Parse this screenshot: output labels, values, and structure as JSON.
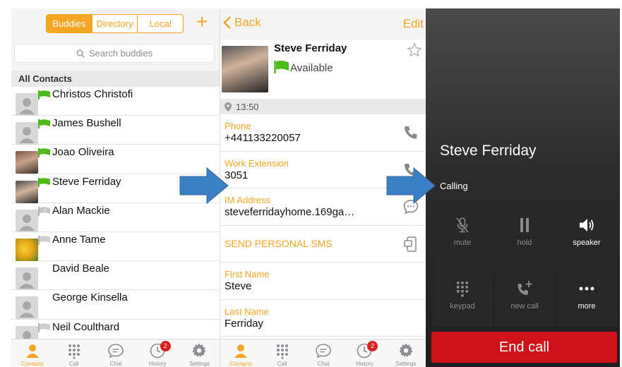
{
  "contacts_panel": {
    "segments": [
      {
        "label": "Buddies",
        "active": true
      },
      {
        "label": "Directory",
        "active": false
      },
      {
        "label": "Local",
        "active": false
      }
    ],
    "add_icon": "plus-icon",
    "search_placeholder": "Search buddies",
    "section_header": "All Contacts",
    "contacts": [
      {
        "name": "Christos Christofi",
        "presence": "available",
        "avatar": "default"
      },
      {
        "name": "James Bushell",
        "presence": "available",
        "avatar": "default"
      },
      {
        "name": "Joao Oliveira",
        "presence": "available",
        "avatar": "photo"
      },
      {
        "name": "Steve Ferriday",
        "presence": "available",
        "avatar": "photo"
      },
      {
        "name": "Alan Mackie",
        "presence": "unknown",
        "avatar": "default"
      },
      {
        "name": "Anne Tame",
        "presence": "offline",
        "avatar": "photo"
      },
      {
        "name": "David Beale",
        "presence": "none",
        "avatar": "default"
      },
      {
        "name": "George Kinsella",
        "presence": "none",
        "avatar": "default"
      },
      {
        "name": "Neil Coulthard",
        "presence": "offline",
        "avatar": "default"
      }
    ]
  },
  "tabbar": {
    "tabs": [
      {
        "label": "Contacts",
        "icon": "person-icon",
        "active": true
      },
      {
        "label": "Call",
        "icon": "keypad-icon",
        "active": false
      },
      {
        "label": "Chat",
        "icon": "chat-icon",
        "active": false
      },
      {
        "label": "History",
        "icon": "clock-icon",
        "active": false,
        "badge": "2"
      },
      {
        "label": "Settings",
        "icon": "gear-icon",
        "active": false
      }
    ]
  },
  "detail_panel": {
    "back_label": "Back",
    "edit_label": "Edit",
    "name": "Steve Ferriday",
    "status": "Available",
    "local_time": "13:50",
    "fields": [
      {
        "label": "Phone",
        "value": "+441133220057",
        "icon": "phone-icon"
      },
      {
        "label": "Work Extension",
        "value": "3051",
        "icon": "phone-icon"
      },
      {
        "label": "IM Address",
        "value": "steveferridayhome.169ga…",
        "icon": "chat-bubble-icon"
      },
      {
        "label": "SEND PERSONAL SMS",
        "value": "",
        "icon": "sms-icon"
      },
      {
        "label": "First Name",
        "value": "Steve",
        "icon": ""
      },
      {
        "label": "Last Name",
        "value": "Ferriday",
        "icon": ""
      }
    ]
  },
  "call_panel": {
    "name": "Steve Ferriday",
    "status": "Calling",
    "buttons": [
      {
        "label": "mute",
        "icon": "mic-off-icon",
        "enabled": false
      },
      {
        "label": "hold",
        "icon": "pause-icon",
        "enabled": false
      },
      {
        "label": "speaker",
        "icon": "speaker-icon",
        "enabled": true
      },
      {
        "label": "keypad",
        "icon": "keypad-icon",
        "enabled": false
      },
      {
        "label": "new call",
        "icon": "add-call-icon",
        "enabled": false
      },
      {
        "label": "more",
        "icon": "more-icon",
        "enabled": true
      }
    ],
    "end_call_label": "End call"
  },
  "colors": {
    "accent": "#f5a623",
    "presence_available": "#4cbb17",
    "end_call": "#d0111a",
    "arrow": "#3b7fc4",
    "badge": "#e02020"
  }
}
